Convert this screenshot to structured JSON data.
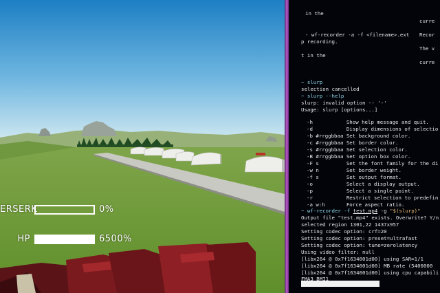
{
  "hud": {
    "berserk": {
      "label": "ERSERK",
      "value": "0%",
      "fill": 0.0
    },
    "hp": {
      "label": "HP",
      "value": "6500%",
      "fill": 1.0
    }
  },
  "terminal": {
    "lines": [
      "in the",
      "curre",
      "- wf-recorder -a -f <filename>.ext",
      "Recor",
      "p recording.",
      "The v",
      "t in the",
      "curre",
      "~ slurp",
      "selection cancelled",
      "~ slurp --help",
      "slurp: invalid option -- '-'",
      "Usage: slurp [options...]",
      "-h           Show help message and quit.",
      "-d           Display dimensions of selectio",
      "-b #rrggbbaa Set background color.",
      "-c #rrggbbaa Set border color.",
      "-s #rrggbbaa Set selection color.",
      "-B #rrggbbaa Set option box color.",
      "-F s         Set the font family for the di",
      "-w n         Set border weight.",
      "-f s         Set output format.",
      "-o           Select a display output.",
      "-p           Select a single point.",
      "-r           Restrict selection to predefin",
      "-a w:h       Force aspect ratio.",
      "~ wf-recorder -f ",
      "test.mp4",
      " -g ",
      "\"$(slurp)\"",
      "Output file \"test.mp4\" exists. Overwrite? Y/n",
      "selected region 1301,22 1437x957",
      "Setting codec option: crf=20",
      "Setting codec option: preset=ultrafast",
      "Setting codec option: tune=zerolatency",
      "Using video filter: null",
      "[libx264 @ 0x7f1634001d00] using SAR=1/1",
      "[libx264 @ 0x7f1634001d00] MB rate (5400000",
      "[libx264 @ 0x7f1634001d00] using cpu capabili",
      "FMA3 BMI1"
    ]
  },
  "colors": {
    "sky_top": "#1d7fc4",
    "sky_bottom": "#bfe0ee",
    "grass": "#6e9a36",
    "terminal_bg": "#02040a",
    "prompt": "#8fd7e8",
    "border_accent": "#c05ac8",
    "hud_text": "#ffffff"
  }
}
